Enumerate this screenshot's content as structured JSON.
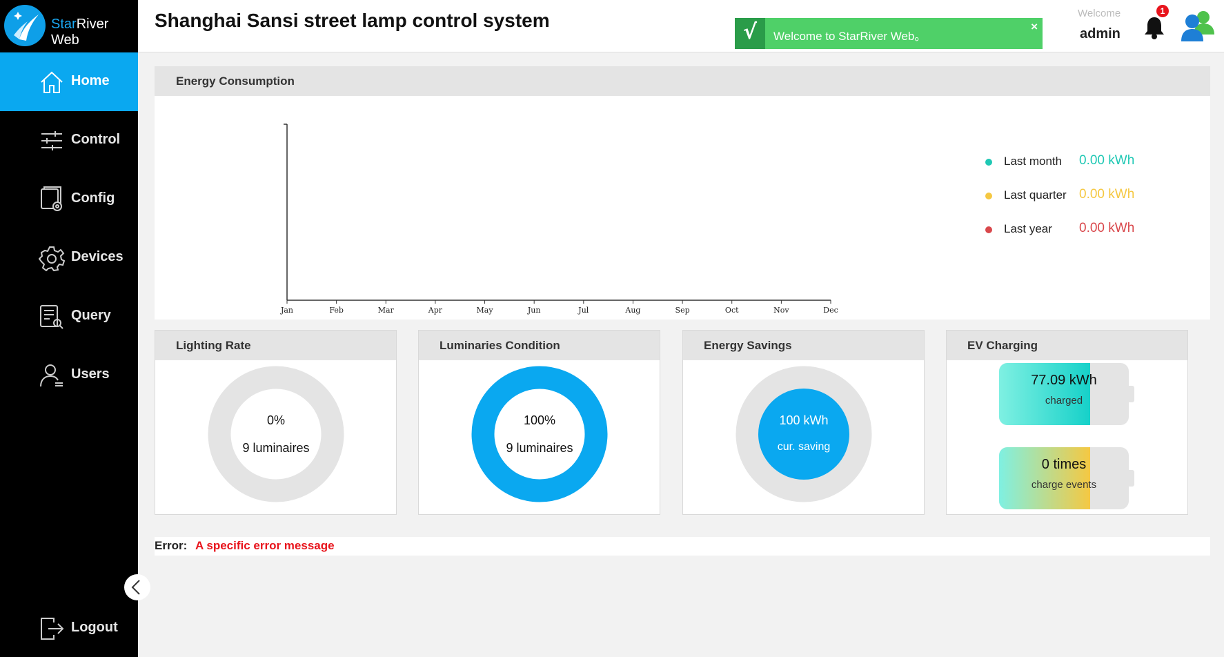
{
  "app": {
    "brand_prefix": "Star",
    "brand_suffix": "River Web",
    "title": "Shanghai Sansi street lamp control system"
  },
  "sidebar": {
    "items": [
      {
        "label": "Home",
        "icon": "home-icon",
        "active": true
      },
      {
        "label": "Control",
        "icon": "sliders-icon"
      },
      {
        "label": "Config",
        "icon": "config-icon"
      },
      {
        "label": "Devices",
        "icon": "gear-icon"
      },
      {
        "label": "Query",
        "icon": "query-icon"
      },
      {
        "label": "Users",
        "icon": "user-icon"
      }
    ],
    "logout_label": "Logout"
  },
  "header": {
    "toast": "Welcome to StarRiver Web。",
    "toast_check": "√",
    "toast_close": "×",
    "welcome_label": "Welcome",
    "user": "admin",
    "notification_count": "1"
  },
  "energy": {
    "title": "Energy Consumption",
    "legend": [
      {
        "name": "Last month",
        "value": "0.00 kWh",
        "color": "#1fc8b4"
      },
      {
        "name": "Last quarter",
        "value": "0.00 kWh",
        "color": "#f5c842"
      },
      {
        "name": "Last year",
        "value": "0.00 kWh",
        "color": "#d9474b"
      }
    ]
  },
  "chart_data": {
    "type": "line",
    "categories": [
      "Jan",
      "Feb",
      "Mar",
      "Apr",
      "May",
      "Jun",
      "Jul",
      "Aug",
      "Sep",
      "Oct",
      "Nov",
      "Dec"
    ],
    "series": []
  },
  "cards": {
    "lighting": {
      "title": "Lighting Rate",
      "percent": "0%",
      "count": "9 luminaires",
      "fraction": 0
    },
    "luminaires": {
      "title": "Luminaries Condition",
      "percent": "100%",
      "count": "9 luminaires",
      "fraction": 1
    },
    "savings": {
      "title": "Energy Savings",
      "value": "100 kWh",
      "caption": "cur. saving"
    },
    "ev": {
      "title": "EV Charging",
      "charged_value": "77.09 kWh",
      "charged_caption": "charged",
      "events_value": "0 times",
      "events_caption": "charge events"
    }
  },
  "error": {
    "label": "Error:",
    "message": "A specific error message"
  },
  "colors": {
    "accent": "#0aa8f0",
    "error": "#e8141c",
    "toast": "#4fd068"
  }
}
